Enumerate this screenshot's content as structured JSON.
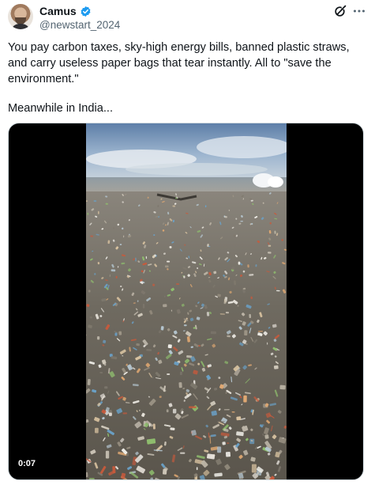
{
  "author": {
    "display_name": "Camus",
    "handle": "@newstart_2024",
    "verified": true,
    "verified_color": "#1d9bf0"
  },
  "header_actions": {
    "grok_icon": "grok-icon",
    "more_icon": "more-horizontal-icon"
  },
  "tweet": {
    "text": "You pay carbon taxes, sky-high energy bills, banned plastic straws, and carry useless paper bags that tear instantly. All to \"save the environment.\"",
    "text_2": "Meanwhile in India..."
  },
  "media": {
    "type": "video",
    "duration": "0:07",
    "scene": "beach covered in plastic waste"
  }
}
